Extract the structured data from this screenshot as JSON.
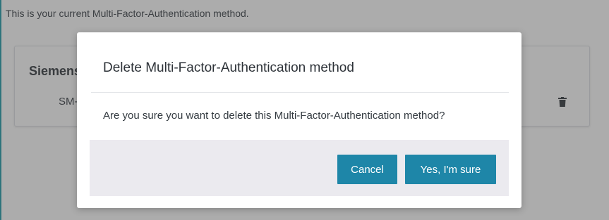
{
  "page": {
    "intro_text": "This is your current Multi-Factor-Authentication method.",
    "card": {
      "title": "Siemens",
      "subtitle": "SM-",
      "delete_icon": "trash-icon"
    }
  },
  "modal": {
    "title": "Delete Multi-Factor-Authentication method",
    "message": "Are you sure you want to delete this Multi-Factor-Authentication method?",
    "cancel_label": "Cancel",
    "confirm_label": "Yes, I'm sure"
  },
  "colors": {
    "frame_border": "#1a9aa8",
    "button": "#1e86a8",
    "footer_bg": "#ebeaef"
  }
}
